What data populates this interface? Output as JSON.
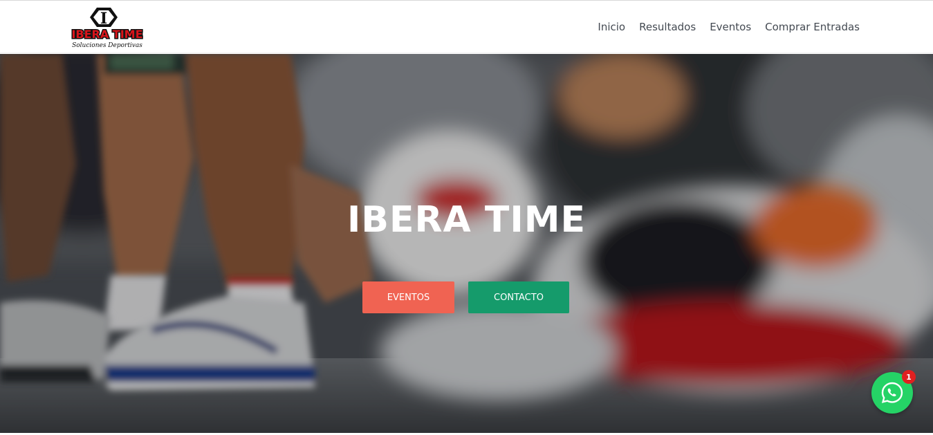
{
  "brand": {
    "logo_letter": "I",
    "logo_name": "IBERA TIME",
    "logo_tagline": "Soluciones Deportivas"
  },
  "nav": {
    "items": [
      "Inicio",
      "Resultados",
      "Eventos",
      "Comprar Entradas"
    ]
  },
  "hero": {
    "title": "IBERA TIME",
    "buttons": {
      "eventos": "EVENTOS",
      "contacto": "CONTACTO"
    }
  },
  "whatsapp": {
    "badge_count": "1",
    "icon": "whatsapp-icon"
  },
  "colors": {
    "eventos_button": "#f06352",
    "contacto_button": "#159b6b",
    "whatsapp": "#25d366",
    "badge": "#e02020",
    "logo_red": "#d8151b",
    "nav_text": "#444a52"
  }
}
